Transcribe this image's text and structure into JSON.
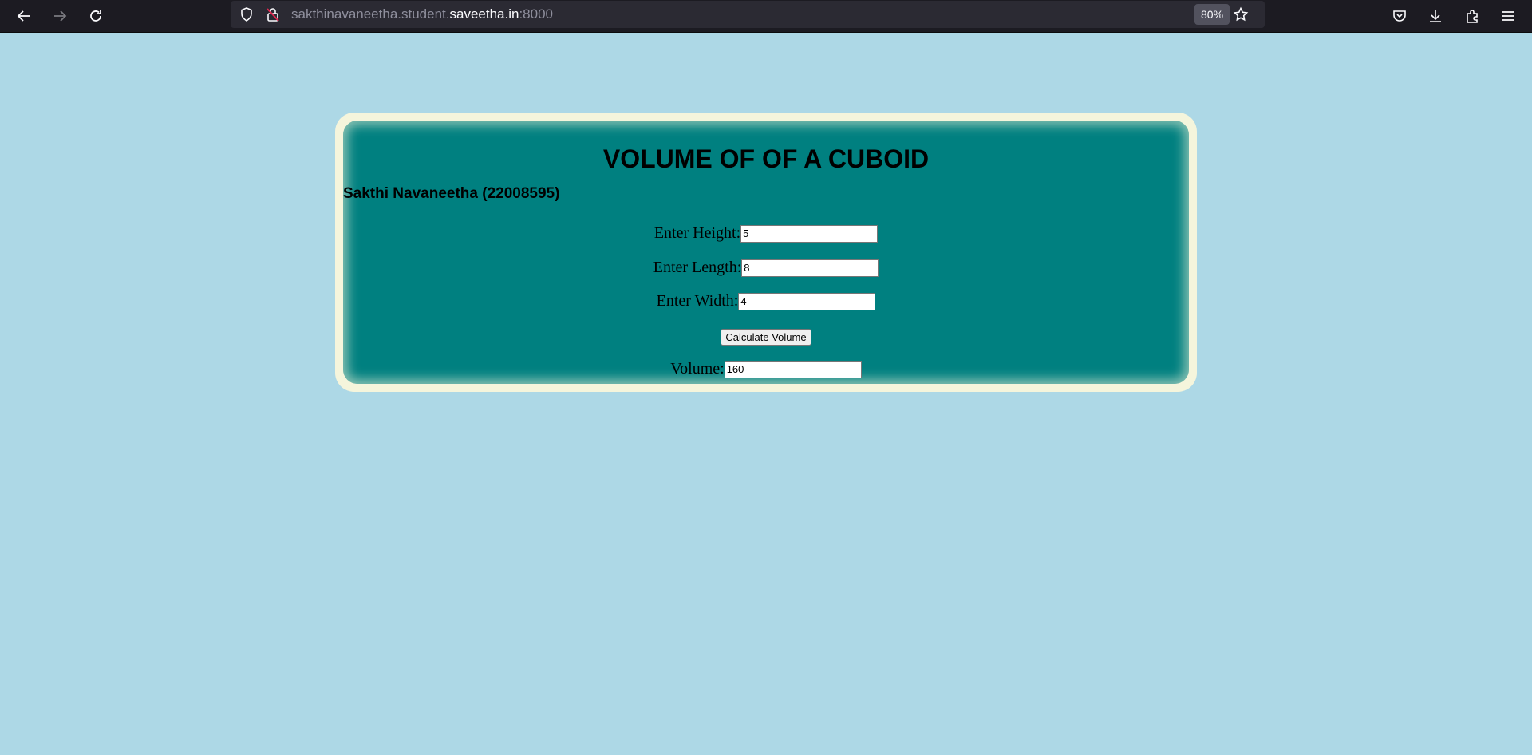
{
  "browser": {
    "url_prefix": "sakthinavaneetha.student.",
    "url_domain": "saveetha.in",
    "url_suffix": ":8000",
    "zoom": "80%"
  },
  "page": {
    "title": "VOLUME OF OF A CUBOID",
    "author": "Sakthi Navaneetha (22008595)",
    "height_label": "Enter Height:",
    "height_value": "5",
    "length_label": "Enter Length:",
    "length_value": "8",
    "width_label": "Enter Width:",
    "width_value": "4",
    "button_label": "Calculate Volume",
    "volume_label": "Volume:",
    "volume_value": "160"
  },
  "colors": {
    "page_background": "#add8e6",
    "card_border": "#f5f5dc",
    "card_background": "#008080"
  }
}
